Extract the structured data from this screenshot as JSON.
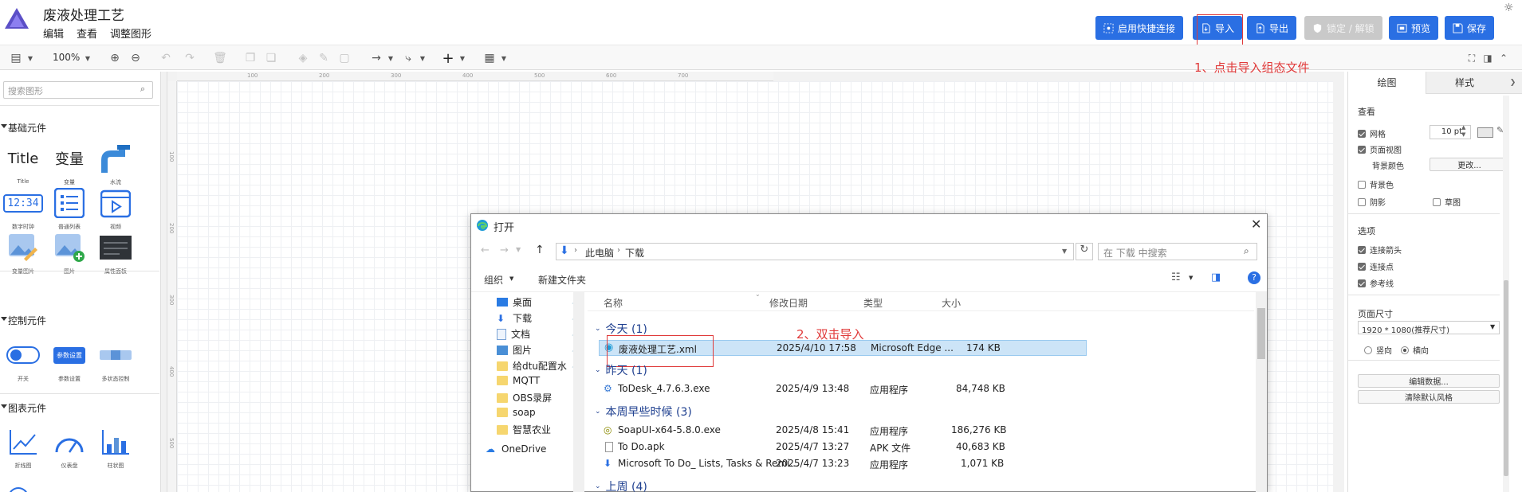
{
  "app": {
    "title": "废液处理工艺",
    "menus": [
      "编辑",
      "查看",
      "调整图形"
    ]
  },
  "toolbar_top": {
    "quick_connect": "启用快捷连接",
    "import": "导入",
    "export": "导出",
    "lock": "锁定 / 解锁",
    "preview": "预览",
    "save": "保存",
    "annotation1": "1、点击导入组态文件",
    "accent": "#2a6fe3"
  },
  "toolbar": {
    "zoom": "100%"
  },
  "sidebar": {
    "search_placeholder": "搜索图形",
    "categories": [
      {
        "name": "基础元件",
        "items": [
          "Title",
          "变量",
          "水流",
          "数字时钟",
          "普通列表",
          "视频",
          "变量图片",
          "图片",
          "属性面板"
        ]
      },
      {
        "name": "控制元件",
        "items": [
          "开关",
          "参数设置",
          "多状态控制"
        ]
      },
      {
        "name": "图表元件",
        "items": [
          "折线图",
          "仪表盘",
          "柱状图"
        ]
      }
    ],
    "icon_texts": {
      "title": "Title",
      "var": "变量",
      "clock": "12:34",
      "param": "参数设置"
    }
  },
  "ruler": {
    "h": [
      "100",
      "200",
      "300",
      "400",
      "500",
      "600",
      "700"
    ],
    "v": [
      "100",
      "200",
      "300",
      "400",
      "500"
    ]
  },
  "right_panel": {
    "tabs": [
      "绘图",
      "样式"
    ],
    "view_title": "查看",
    "grid": "网格",
    "grid_size": "10 pt",
    "page_view": "页面视图",
    "bg_color": "背景颜色",
    "change": "更改...",
    "bg_image": "背景色",
    "shadow": "阴影",
    "sketch": "草图",
    "options_title": "选项",
    "conn_arrows": "连接箭头",
    "conn_points": "连接点",
    "guides": "参考线",
    "page_size_title": "页面尺寸",
    "page_size": "1920 * 1080(推荐尺寸)",
    "portrait": "竖向",
    "landscape": "横向",
    "edit_data": "编辑数据...",
    "clear_style": "清除默认风格"
  },
  "dialog": {
    "title": "打开",
    "path": [
      "此电脑",
      "下载"
    ],
    "search_placeholder": "在 下载 中搜索",
    "organize": "组织",
    "new_folder": "新建文件夹",
    "nav": [
      "桌面",
      "下载",
      "文档",
      "图片",
      "给dtu配置水",
      "MQTT",
      "OBS录屏",
      "soap",
      "智慧农业",
      "OneDrive"
    ],
    "columns": [
      "名称",
      "修改日期",
      "类型",
      "大小"
    ],
    "annotation2": "2、双击导入",
    "groups": [
      {
        "label": "今天 (1)",
        "files": [
          {
            "name": "废液处理工艺.xml",
            "date": "2025/4/10 17:58",
            "type": "Microsoft Edge ...",
            "size": "174 KB"
          }
        ]
      },
      {
        "label": "昨天 (1)",
        "files": [
          {
            "name": "ToDesk_4.7.6.3.exe",
            "date": "2025/4/9 13:48",
            "type": "应用程序",
            "size": "84,748 KB"
          }
        ]
      },
      {
        "label": "本周早些时候 (3)",
        "files": [
          {
            "name": "SoapUI-x64-5.8.0.exe",
            "date": "2025/4/8 15:41",
            "type": "应用程序",
            "size": "186,276 KB"
          },
          {
            "name": "To Do.apk",
            "date": "2025/4/7 13:27",
            "type": "APK 文件",
            "size": "40,683 KB"
          },
          {
            "name": "Microsoft To Do_ Lists, Tasks & Remi...",
            "date": "2025/4/7 13:23",
            "type": "应用程序",
            "size": "1,071 KB"
          }
        ]
      },
      {
        "label": "上周 (4)",
        "files": []
      }
    ]
  }
}
